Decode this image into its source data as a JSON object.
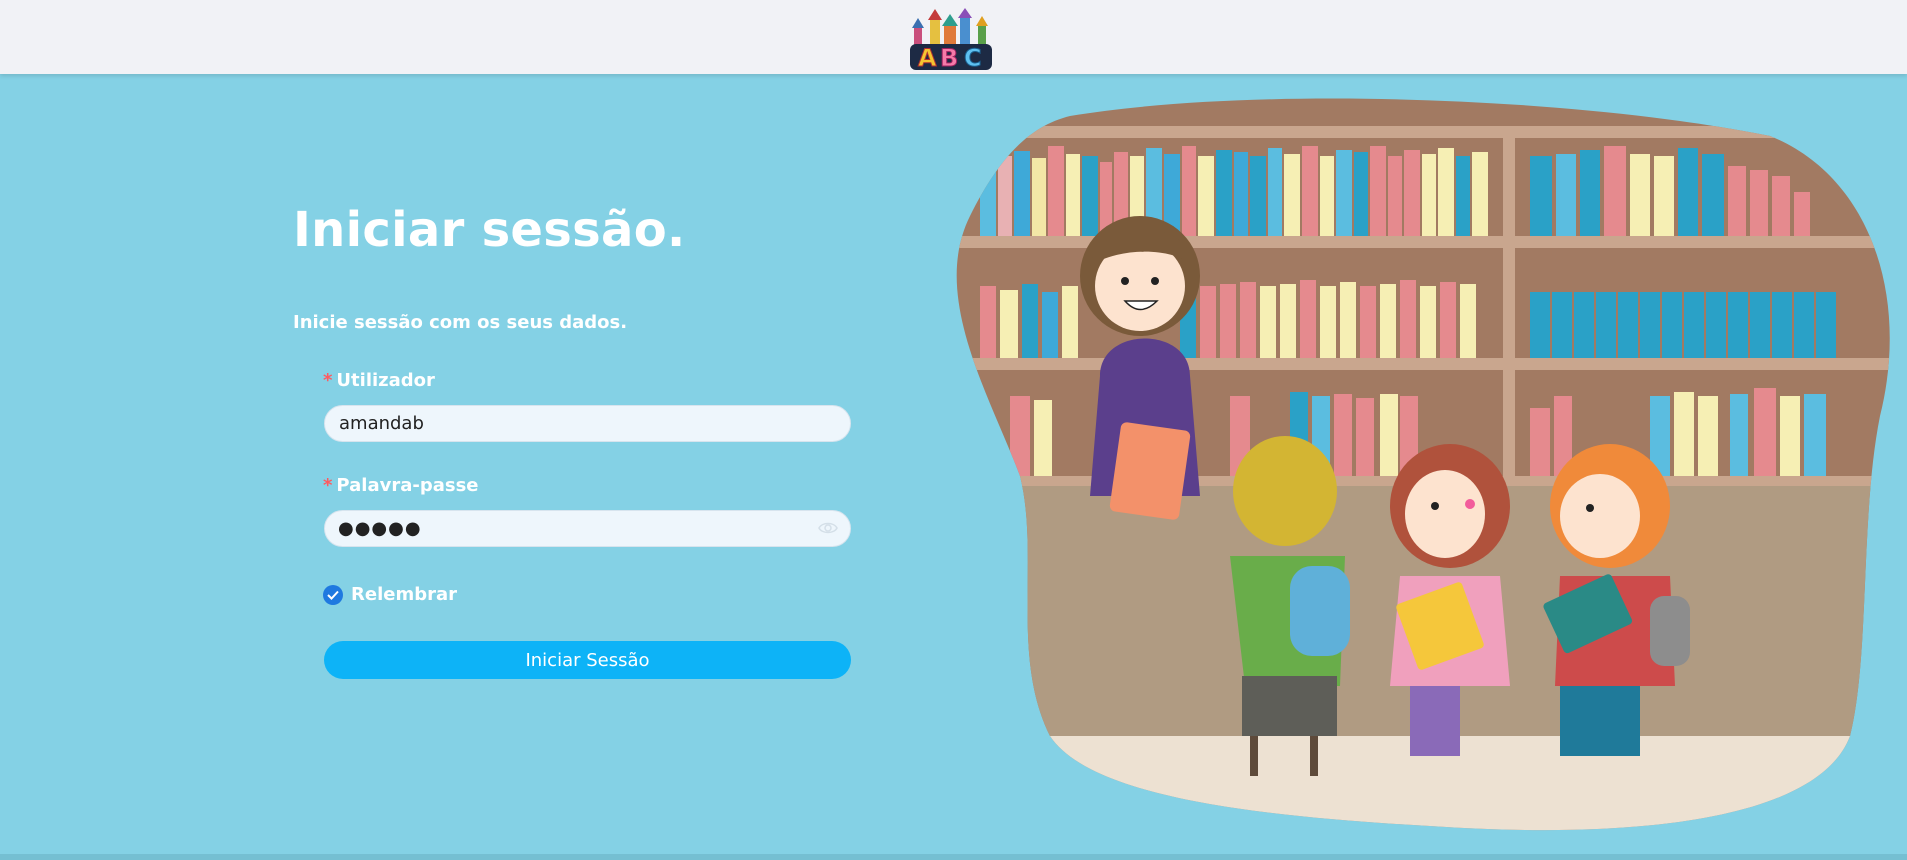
{
  "header": {
    "logo_text": "ABC",
    "logo_icon": "abc-castle-logo"
  },
  "login": {
    "title": "Iniciar sessão.",
    "subtitle": "Inicie sessão com os seus dados.",
    "required_mark": "*",
    "username_label": "Utilizador",
    "username_value": "amandab",
    "password_label": "Palavra-passe",
    "password_masked": "●●●●●",
    "remember_label": "Relembrar",
    "remember_checked": true,
    "submit_label": "Iniciar Sessão"
  },
  "icons": {
    "password_toggle": "eye-icon",
    "checkbox": "check-icon"
  },
  "colors": {
    "background": "#84d1e5",
    "topbar": "#f1f2f6",
    "button": "#0db3f7",
    "required": "#ff5a5f",
    "checkbox": "#1f79e0"
  },
  "illustration": {
    "subject": "teacher-and-children-library-illustration"
  }
}
